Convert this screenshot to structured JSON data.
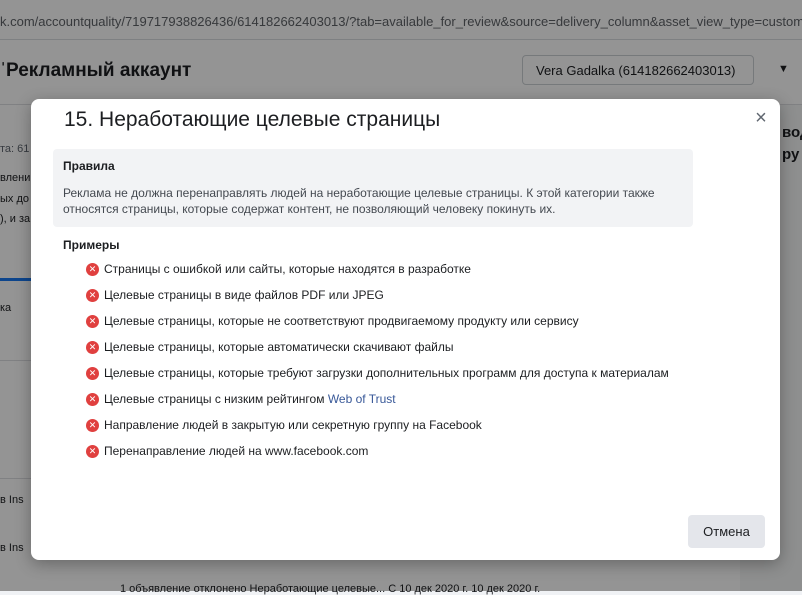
{
  "browser": {
    "url": "k.com/accountquality/719717938826436/614182662403013/?tab=available_for_review&source=delivery_column&asset_view_type=custom"
  },
  "header": {
    "title": "Рекламный аккаунт",
    "account_selector": "Vera Gadalka (614182662403013)"
  },
  "background_fragments": {
    "left_1": "та: 61",
    "left_2": "влени",
    "left_3": "ых до",
    "left_4": "), и за",
    "left_5": "ка",
    "left_6": "в Ins",
    "left_7": "в Ins",
    "right_1": "вод",
    "right_2": "ру",
    "bottom_row": "1 объявление отклонено   Неработающие целевые...   С 10 дек 2020 г.        10 дек 2020 г."
  },
  "modal": {
    "title": "15. Неработающие целевые страницы",
    "close_label": "×",
    "rules_heading": "Правила",
    "rules_text": "Реклама не должна перенаправлять людей на неработающие целевые страницы. К этой категории также относятся страницы, которые содержат контент, не позволяющий человеку покинуть их.",
    "examples_heading": "Примеры",
    "examples": [
      "Страницы с ошибкой или сайты, которые находятся в разработке",
      "Целевые страницы в виде файлов PDF или JPEG",
      "Целевые страницы, которые не соответствуют продвигаемому продукту или сервису",
      "Целевые страницы, которые автоматически скачивают файлы",
      "Целевые страницы, которые требуют загрузки дополнительных программ для доступа к материалам",
      "Целевые страницы с низким рейтингом",
      "Направление людей в закрытую или секретную группу на Facebook",
      "Перенаправление людей на www.facebook.com"
    ],
    "example_link": "Web of Trust",
    "cancel_label": "Отмена"
  },
  "colors": {
    "error_icon": "#e0403f",
    "link": "#385898",
    "accent": "#1877f2"
  }
}
